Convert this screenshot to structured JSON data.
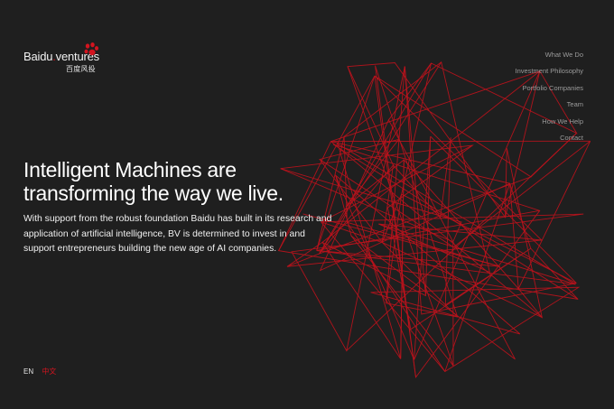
{
  "brand": {
    "logo_text": "Baidu",
    "logo_dot": ".",
    "logo_text2": "ventures",
    "logo_sub": "百度风投",
    "accent": "#d3141f",
    "paw_icon": "paw-icon"
  },
  "nav": {
    "items": [
      {
        "label": "What We Do"
      },
      {
        "label": "Investment Philosophy"
      },
      {
        "label": "Portfolio Companies"
      },
      {
        "label": "Team"
      },
      {
        "label": "How We Help"
      },
      {
        "label": "Contact"
      }
    ]
  },
  "hero": {
    "headline": "Intelligent Machines are transforming the way we live.",
    "body": "With support from the robust foundation Baidu has built in its research and application of artificial intelligence, BV is determined to invest in and support entrepreneurs building the new age of AI companies."
  },
  "lang": {
    "en": "EN",
    "zh": "中文"
  },
  "colors": {
    "background": "#1f1f1f",
    "line": "#c0121c"
  }
}
